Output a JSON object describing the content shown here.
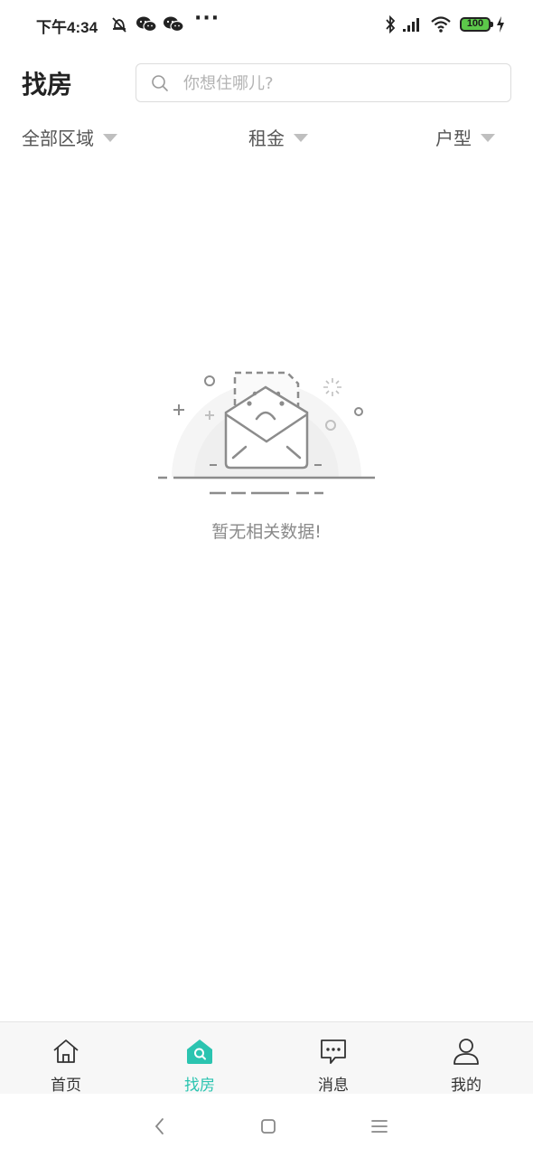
{
  "status_bar": {
    "time": "下午4:34",
    "dots": "···",
    "battery": "100",
    "icons": [
      "alarm-off-icon",
      "wechat-icon",
      "wechat-icon",
      "bluetooth-icon",
      "signal-icon",
      "wifi-icon",
      "battery-icon",
      "charging-icon"
    ]
  },
  "header": {
    "title": "找房",
    "search_placeholder": "你想住哪儿?"
  },
  "filters": [
    {
      "label": "全部区域"
    },
    {
      "label": "租金"
    },
    {
      "label": "户型"
    }
  ],
  "empty_state": {
    "message": "暂无相关数据!"
  },
  "tabs": [
    {
      "label": "首页",
      "icon": "home-icon",
      "active": false
    },
    {
      "label": "找房",
      "icon": "house-search-icon",
      "active": true
    },
    {
      "label": "消息",
      "icon": "message-icon",
      "active": false
    },
    {
      "label": "我的",
      "icon": "user-icon",
      "active": false
    }
  ],
  "colors": {
    "accent": "#2bc4b0",
    "text": "#333333",
    "muted": "#8a8a8a",
    "battery": "#5cc84a"
  }
}
